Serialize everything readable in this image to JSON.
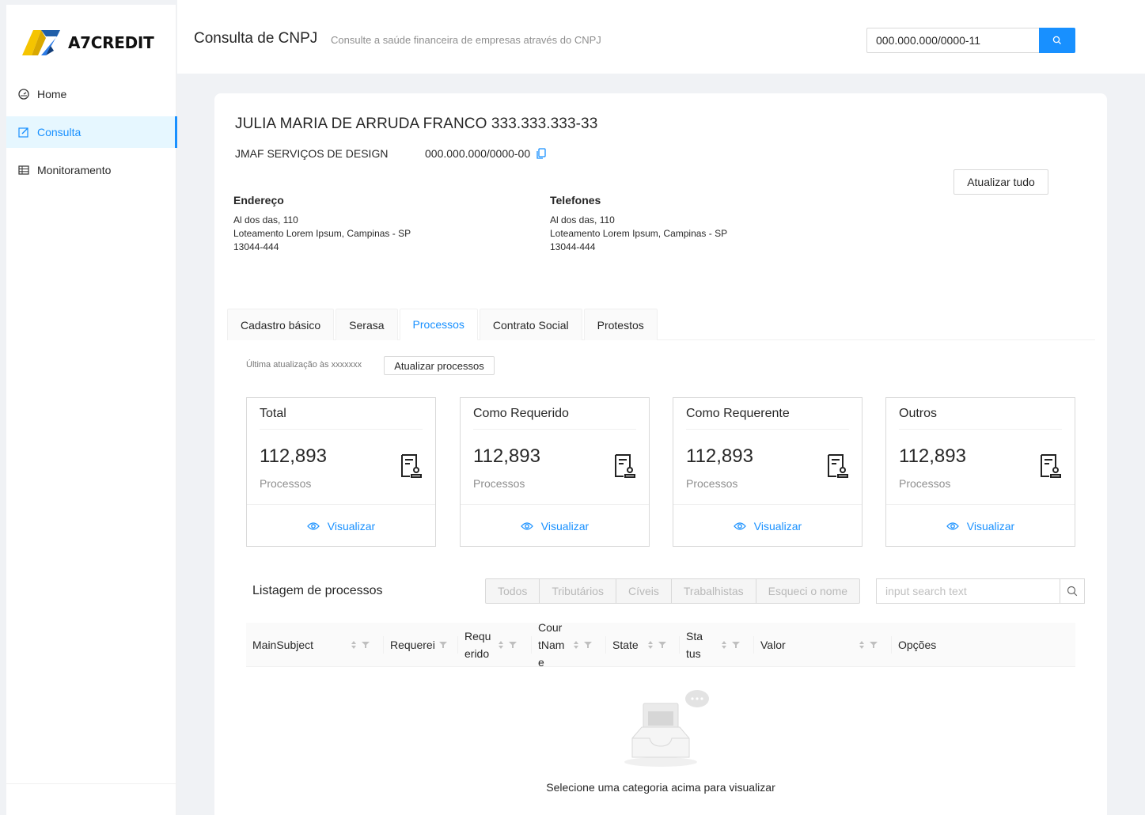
{
  "app": {
    "brand": "A7CREDIT"
  },
  "sidebar": {
    "items": [
      {
        "label": "Home",
        "icon": "dashboard-icon"
      },
      {
        "label": "Consulta",
        "icon": "edit-icon",
        "active": true
      },
      {
        "label": "Monitoramento",
        "icon": "table-icon"
      }
    ]
  },
  "header": {
    "title": "Consulta de CNPJ",
    "subtitle": "Consulte a saúde financeira de empresas através do CNPJ",
    "search_value": "000.000.000/0000-11"
  },
  "company": {
    "person": "JULIA MARIA DE ARRUDA FRANCO 333.333.333-33",
    "name": "JMAF SERVIÇOS DE DESIGN",
    "cnpj": "000.000.000/0000-00",
    "update_all_label": "Atualizar tudo"
  },
  "address": {
    "title": "Endereço",
    "line1": "Al dos das, 110",
    "line2": "Loteamento Lorem Ipsum, Campinas - SP",
    "line3": "13044-444"
  },
  "phones": {
    "title": "Telefones",
    "line1": "Al dos das, 110",
    "line2": "Loteamento Lorem Ipsum, Campinas - SP",
    "line3": "13044-444"
  },
  "tabs": [
    {
      "label": "Cadastro básico"
    },
    {
      "label": "Serasa"
    },
    {
      "label": "Processos",
      "active": true
    },
    {
      "label": "Contrato Social"
    },
    {
      "label": "Protestos"
    }
  ],
  "processos": {
    "last_update": "Última atualização às xxxxxxx",
    "update_label": "Atualizar processos",
    "stats": [
      {
        "title": "Total",
        "value": "112,893",
        "label": "Processos",
        "action": "Visualizar"
      },
      {
        "title": "Como Requerido",
        "value": "112,893",
        "label": "Processos",
        "action": "Visualizar"
      },
      {
        "title": "Como Requerente",
        "value": "112,893",
        "label": "Processos",
        "action": "Visualizar"
      },
      {
        "title": "Outros",
        "value": "112,893",
        "label": "Processos",
        "action": "Visualizar"
      }
    ]
  },
  "listing": {
    "title": "Listagem de processos",
    "filters": [
      "Todos",
      "Tributários",
      "Cíveis",
      "Trabalhistas",
      "Esqueci o nome"
    ],
    "search_placeholder": "input search text",
    "columns": [
      {
        "line1": "MainSubject"
      },
      {
        "line1": "Requerei"
      },
      {
        "line1": "Requ",
        "line2": "erido"
      },
      {
        "line1": "Cour",
        "line2": "tNam",
        "line3": "e"
      },
      {
        "line1": "State"
      },
      {
        "line1": "Sta",
        "line2": "tus"
      },
      {
        "line1": "Valor"
      },
      {
        "line1": "Opções"
      }
    ],
    "empty_text": "Selecione uma categoria acima para visualizar"
  },
  "colors": {
    "primary": "#1890ff",
    "logo_yellow": "#f5c400",
    "logo_blue": "#1f5ea8"
  }
}
